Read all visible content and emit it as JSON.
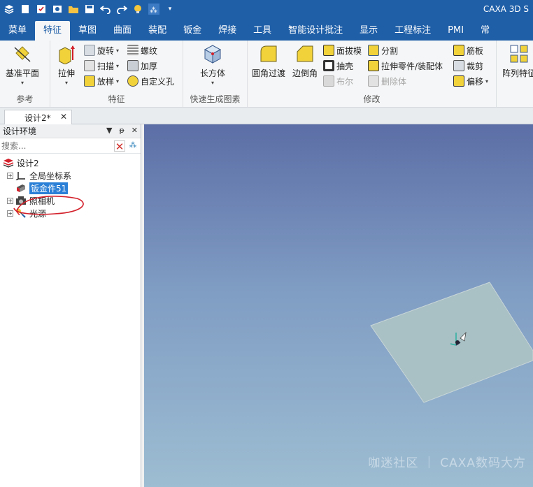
{
  "app": {
    "title": "CAXA 3D S"
  },
  "quick_access": [
    "app-logo-icon",
    "new-file-icon",
    "open-file-icon",
    "print-icon",
    "folder-icon",
    "save-icon",
    "undo-icon",
    "redo-icon",
    "lightbulb-icon",
    "filter-icon",
    "dropdown-icon"
  ],
  "menu_tabs": [
    "菜单",
    "特征",
    "草图",
    "曲面",
    "装配",
    "钣金",
    "焊接",
    "工具",
    "智能设计批注",
    "显示",
    "工程标注",
    "PMI",
    "常"
  ],
  "active_tab": "特征",
  "ribbon": {
    "ref_group": {
      "label": "参考",
      "datum_plane": "基准平面"
    },
    "feature_group": {
      "label": "特征",
      "extrude": "拉伸",
      "revolve": "旋转",
      "sweep": "扫描",
      "loft": "放样",
      "thread": "螺纹",
      "thicken": "加厚",
      "custom_hole": "自定义孔"
    },
    "quick_group": {
      "label": "快速生成图素",
      "box": "长方体"
    },
    "modify_group": {
      "label": "修改",
      "fillet": "圆角过渡",
      "chamfer": "边倒角",
      "draft": "面拔模",
      "shell": "抽壳",
      "boolean": "布尔",
      "split": "分割",
      "stretch_part": "拉伸零件/装配体",
      "delete_body": "删除体",
      "rib": "筋板",
      "trim": "裁剪",
      "offset": "偏移"
    },
    "array_group": {
      "array_feature": "阵列特征"
    }
  },
  "document": {
    "tab_label": "设计2*"
  },
  "design_env": {
    "title": "设计环境",
    "search_placeholder": "搜索...",
    "tree": {
      "root": "设计2",
      "items": [
        {
          "label": "全局坐标系",
          "expandable": true
        },
        {
          "label": "钣金件51",
          "selected": true
        },
        {
          "label": "照相机",
          "expandable": true
        },
        {
          "label": "光源",
          "expandable": true
        }
      ]
    }
  },
  "viewport": {
    "watermark": "咖迷社区 ｜ CAXA数码大方"
  },
  "colors": {
    "title_bar": "#1f5fa8",
    "selection": "#2a7fd6",
    "annotation": "#d3202a",
    "plate_fill": "#a9c0c4"
  }
}
